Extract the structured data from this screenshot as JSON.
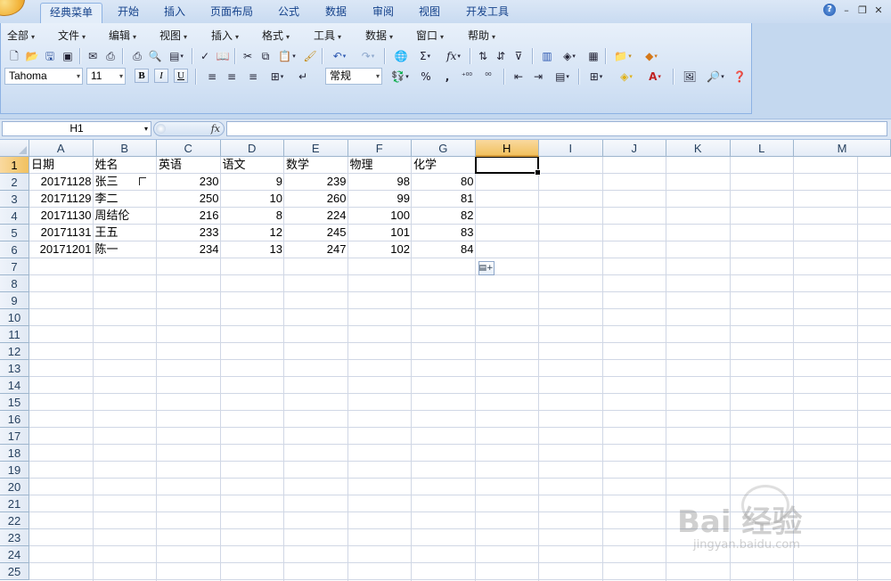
{
  "tabs": [
    {
      "label": "经典菜单",
      "active": true
    },
    {
      "label": "开始"
    },
    {
      "label": "插入"
    },
    {
      "label": "页面布局"
    },
    {
      "label": "公式"
    },
    {
      "label": "数据"
    },
    {
      "label": "审阅"
    },
    {
      "label": "视图"
    },
    {
      "label": "开发工具"
    }
  ],
  "window_controls": {
    "help": "?",
    "minimize": "–",
    "restore": "❐",
    "close": "✕"
  },
  "menus": [
    "全部",
    "文件",
    "编辑",
    "视图",
    "插入",
    "格式",
    "工具",
    "数据",
    "窗口",
    "帮助"
  ],
  "format_bar": {
    "font_name": "Tahoma",
    "font_size": "11",
    "bold": "B",
    "italic": "I",
    "underline": "U",
    "number_format": "常规",
    "percent": "%",
    "comma": ","
  },
  "toolbar_symbols": {
    "sum": "Σ",
    "function": "fx"
  },
  "formula_bar": {
    "name_box": "H1",
    "fx": "fx",
    "formula": ""
  },
  "sheet": {
    "columns": [
      "A",
      "B",
      "C",
      "D",
      "E",
      "F",
      "G",
      "H",
      "I",
      "J",
      "K",
      "L",
      "M"
    ],
    "rows": [
      "1",
      "2",
      "3",
      "4",
      "5",
      "6",
      "7",
      "8",
      "9",
      "10",
      "11",
      "12",
      "13",
      "14",
      "15",
      "16",
      "17",
      "18",
      "19",
      "20",
      "21",
      "22",
      "23",
      "24",
      "25"
    ],
    "selected_column": "H",
    "selected_row": "1",
    "header_row": [
      "日期",
      "姓名",
      "英语",
      "语文",
      "数学",
      "物理",
      "化学"
    ],
    "data_rows": [
      [
        "20171128",
        "张三",
        "230",
        "9",
        "239",
        "98",
        "80"
      ],
      [
        "20171129",
        "李二",
        "250",
        "10",
        "260",
        "99",
        "81"
      ],
      [
        "20171130",
        "周结伦",
        "216",
        "8",
        "224",
        "100",
        "82"
      ],
      [
        "20171131",
        "王五",
        "233",
        "12",
        "245",
        "101",
        "83"
      ],
      [
        "20171201",
        "陈一",
        "234",
        "13",
        "247",
        "102",
        "84"
      ]
    ]
  },
  "watermark": {
    "brand": "Bai 经验",
    "url": "jingyan.baidu.com"
  },
  "colors": {
    "ribbon": "#c4d8ef",
    "tab_text": "#15428b",
    "selected_header": "#f1c15f",
    "gridline": "#d0d7e5"
  }
}
